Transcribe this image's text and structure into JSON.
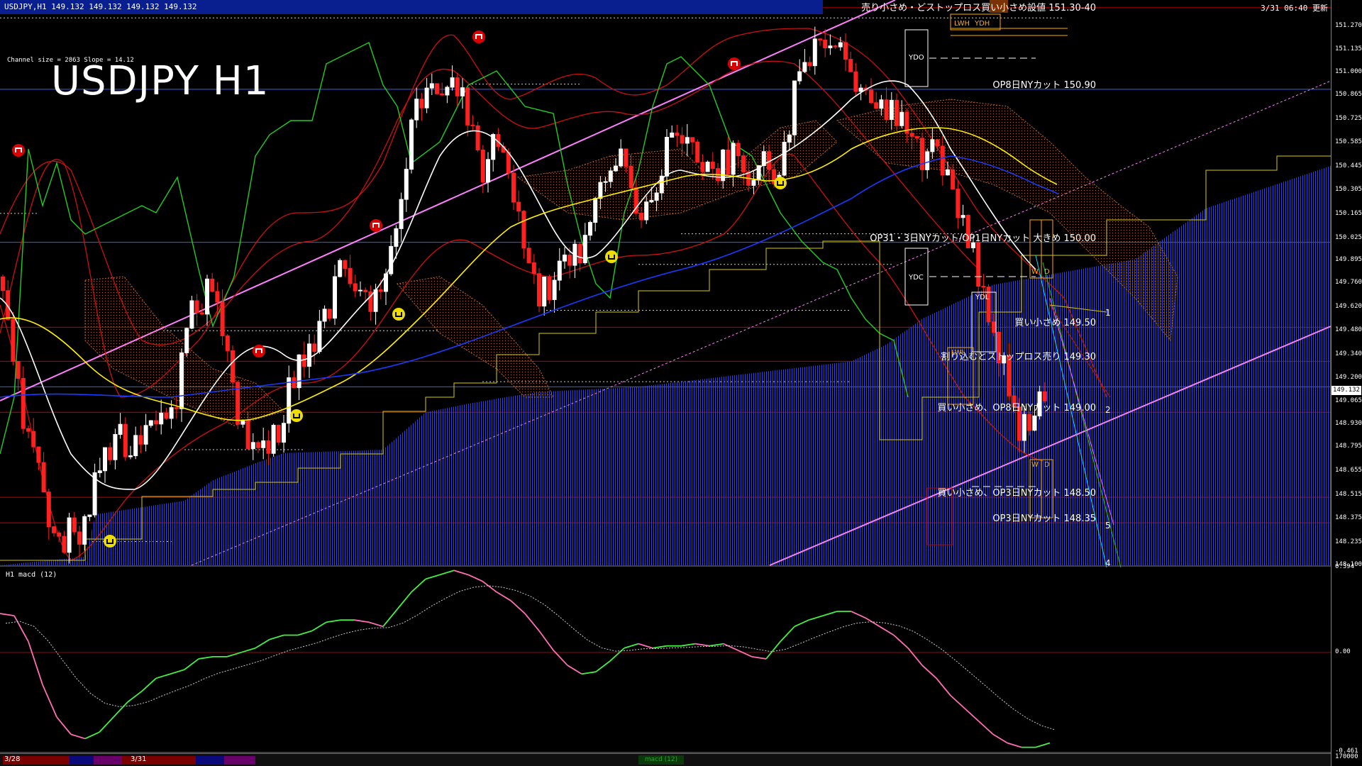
{
  "window": {
    "symbol_info": "USDJPY,H1  149.132 149.132 149.132 149.132",
    "top_right_label": "3/31 06:40 更新",
    "big_title": "USDJPY H1",
    "channel_info": "Channel size = 2863 Slope = 14.12",
    "macd_label": "H1 macd (12)"
  },
  "annotations": [
    {
      "text": "売り小さめ・どストップロス買い小さめ設値 151.30-40",
      "price": 151.38,
      "side": "right",
      "anchor": 1545
    },
    {
      "text": "OP8日NYカット 150.90",
      "price": 150.9,
      "side": "right",
      "anchor": 1545
    },
    {
      "text": "OP31・3日NYカット/OP1日NYカット 大きめ 150.00",
      "price": 150.0,
      "side": "right",
      "anchor": 1545
    },
    {
      "text": "買い小さめ 149.50",
      "price": 149.5,
      "side": "right",
      "anchor": 1545
    },
    {
      "text": "割り込むとストップロス売り 149.30",
      "price": 149.3,
      "side": "right",
      "anchor": 1545
    },
    {
      "text": "買い小さめ、OP8日NYカット 149.00",
      "price": 149.0,
      "side": "right",
      "anchor": 1545
    },
    {
      "text": "買い小さめ、OP3日NYカット 148.50",
      "price": 148.5,
      "side": "right",
      "anchor": 1545
    },
    {
      "text": "OP3日NYカット 148.35",
      "price": 148.35,
      "side": "right",
      "anchor": 1545
    }
  ],
  "wave_numbers": [
    {
      "label": "1",
      "price": 149.58
    },
    {
      "label": "2",
      "price": 149.01
    },
    {
      "label": "5",
      "price": 148.33
    },
    {
      "label": "4",
      "price": 148.11
    }
  ],
  "box_labels": [
    {
      "text": "YDO",
      "color": "#ffffff"
    },
    {
      "text": "YDC",
      "color": "#ffffff"
    },
    {
      "text": "YDL",
      "color": "#ffffff"
    },
    {
      "text": "LWH",
      "color": "#ffaa00"
    },
    {
      "text": "YDH",
      "color": "#ffaa00"
    },
    {
      "text": "LWL",
      "color": "#ffaa00"
    },
    {
      "text": "W",
      "color": "#ffaa00"
    },
    {
      "text": "D",
      "color": "#ffaa00"
    },
    {
      "text": "W",
      "color": "#ffaa00"
    },
    {
      "text": "D",
      "color": "#ffaa00"
    }
  ],
  "price_axis": {
    "ticks": [
      "151.270",
      "151.135",
      "151.000",
      "150.865",
      "150.725",
      "150.585",
      "150.445",
      "150.305",
      "150.165",
      "150.025",
      "149.895",
      "149.760",
      "149.620",
      "149.480",
      "149.340",
      "149.200",
      "149.065",
      "148.930",
      "148.795",
      "148.655",
      "148.515",
      "148.375",
      "148.235",
      "148.100"
    ],
    "current_price": "149.132",
    "macd_ticks": [
      "0.394",
      "0.00",
      "-0.461",
      "170000"
    ]
  },
  "bottom_bar": {
    "date_labels": [
      "3/28",
      "3/31"
    ],
    "macd_tab": "macd (12)"
  },
  "colors": {
    "bull_candle": "#ffffff",
    "bear_candle": "#ff2020",
    "cloud_blue": "#2a3fff",
    "cloud_orange": "#cc7a3a",
    "ma_white": "#ffffff",
    "ma_yellow": "#ffee00",
    "ma_blue": "#1a3aff",
    "channel_pink": "#ff80ff",
    "bollinger_red": "#cc1010",
    "lagging_green": "#22cc22",
    "level_red": "#aa0000",
    "level_blue": "#3060ff",
    "macd_green": "#44ee44",
    "macd_pink": "#ff6eb4"
  },
  "chart_data": {
    "type": "candlestick",
    "symbol": "USDJPY",
    "timeframe": "H1",
    "ylim": [
      148.1,
      151.35
    ],
    "levels": [
      {
        "price": 151.38,
        "color": "#aa0000"
      },
      {
        "price": 150.9,
        "color": "#3060ff"
      },
      {
        "price": 150.0,
        "color": "#3060ff"
      },
      {
        "price": 149.5,
        "color": "#cc0000"
      },
      {
        "price": 149.3,
        "color": "#cc0000"
      },
      {
        "price": 149.15,
        "color": "#3060ff"
      },
      {
        "price": 149.0,
        "color": "#cc0000"
      },
      {
        "price": 148.5,
        "color": "#cc0000"
      },
      {
        "price": 148.35,
        "color": "#cc0000"
      }
    ],
    "macd": {
      "ylim": [
        -0.461,
        0.394
      ]
    }
  }
}
